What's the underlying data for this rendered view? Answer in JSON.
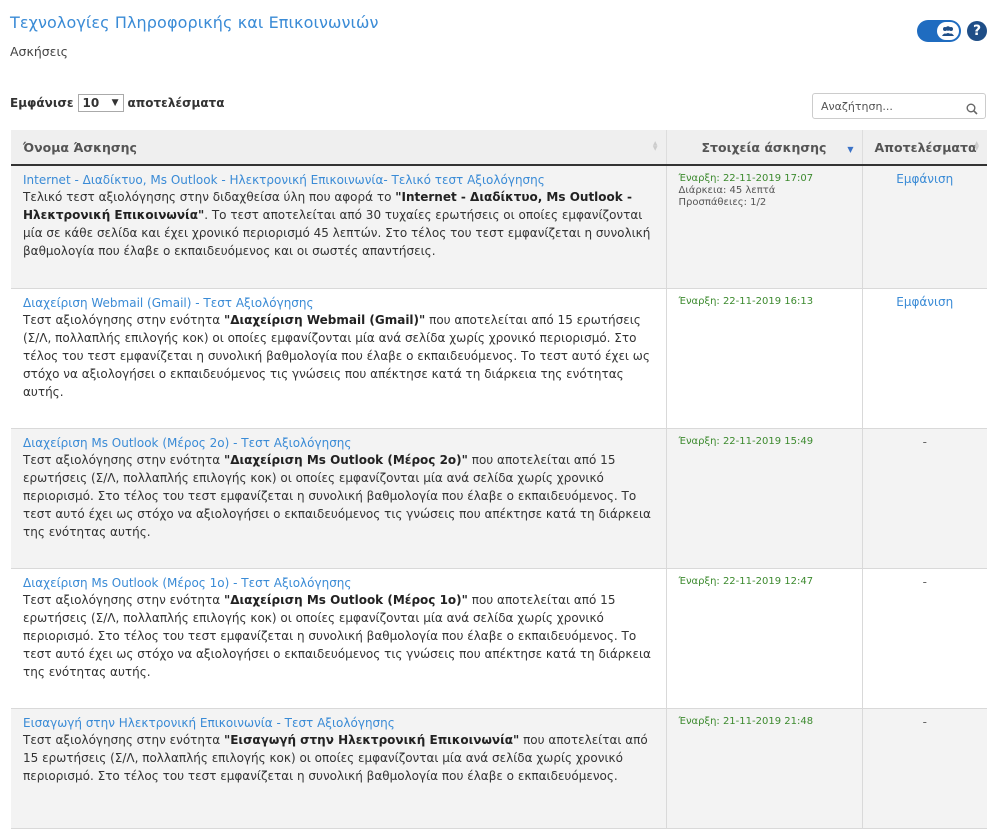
{
  "header": {
    "course_title": "Τεχνολογίες Πληροφορικής και Επικοινωνιών",
    "page_subtitle": "Ασκήσεις"
  },
  "controls": {
    "show_label": "Εμφάνισε",
    "page_size": "10",
    "results_label": "αποτελέσματα",
    "search_placeholder": "Αναζήτηση..."
  },
  "table": {
    "columns": [
      "Όνομα Άσκησης",
      "Στοιχεία άσκησης",
      "Αποτελέσματα"
    ],
    "rows": [
      {
        "title": "Internet - Διαδίκτυο, Ms Outlook - Ηλεκτρονική Επικοινωνία- Τελικό τεστ Αξιολόγησης",
        "desc_pre": "Τελικό τεστ αξιολόγησης στην διδαχθείσα ύλη που αφορά το ",
        "desc_bold": "\"Internet - Διαδίκτυο, Ms Outlook - Ηλεκτρονική Επικοινωνία\"",
        "desc_post": ". Το τεστ αποτελείται από 30 τυχαίες ερωτήσεις οι οποίες εμφανίζονται μία σε κάθε σελίδα και έχει χρονικό περιορισμό 45 λεπτών. Στο τέλος του τεστ εμφανίζεται η συνολική βαθμολογία που έλαβε ο εκπαιδευόμενος και οι σωστές απαντήσεις.",
        "start": "Έναρξη: 22-11-2019 17:07",
        "duration": "Διάρκεια: 45 λεπτά",
        "attempts": "Προσπάθειες: 1/2",
        "result": "Εμφάνιση"
      },
      {
        "title": "Διαχείριση Webmail (Gmail) - Τεστ Αξιολόγησης",
        "desc_pre": "Τεστ αξιολόγησης στην ενότητα ",
        "desc_bold": "\"Διαχείριση Webmail (Gmail)\"",
        "desc_post": " που αποτελείται από 15 ερωτήσεις (Σ/Λ, πολλαπλής επιλογής κοκ) οι οποίες εμφανίζονται μία ανά σελίδα χωρίς χρονικό περιορισμό. Στο τέλος του τεστ εμφανίζεται η συνολική βαθμολογία που έλαβε ο εκπαιδευόμενος. Το τεστ αυτό έχει ως στόχο να αξιολογήσει ο εκπαιδευόμενος τις γνώσεις που απέκτησε κατά τη διάρκεια της ενότητας αυτής.",
        "start": "Έναρξη: 22-11-2019 16:13",
        "duration": "",
        "attempts": "",
        "result": "Εμφάνιση"
      },
      {
        "title": "Διαχείριση Ms Outlook (Μέρος 2ο) - Τεστ Αξιολόγησης",
        "desc_pre": "Τεστ αξιολόγησης στην ενότητα ",
        "desc_bold": "\"Διαχείριση Ms Outlook (Μέρος 2ο)\"",
        "desc_post": " που αποτελείται από 15 ερωτήσεις (Σ/Λ, πολλαπλής επιλογής κοκ) οι οποίες εμφανίζονται μία ανά σελίδα χωρίς χρονικό περιορισμό. Στο τέλος του τεστ εμφανίζεται η συνολική βαθμολογία που έλαβε ο εκπαιδευόμενος. Το τεστ αυτό έχει ως στόχο να αξιολογήσει ο εκπαιδευόμενος τις γνώσεις που απέκτησε κατά τη διάρκεια της ενότητας αυτής.",
        "start": "Έναρξη: 22-11-2019 15:49",
        "duration": "",
        "attempts": "",
        "result": "-"
      },
      {
        "title": "Διαχείριση Ms Outlook (Μέρος 1ο) - Τεστ Αξιολόγησης",
        "desc_pre": "Τεστ αξιολόγησης στην ενότητα ",
        "desc_bold": "\"Διαχείριση Ms Outlook (Μέρος 1ο)\"",
        "desc_post": " που αποτελείται από 15 ερωτήσεις (Σ/Λ, πολλαπλής επιλογής κοκ) οι οποίες εμφανίζονται μία ανά σελίδα χωρίς χρονικό περιορισμό. Στο τέλος του τεστ εμφανίζεται η συνολική βαθμολογία που έλαβε ο εκπαιδευόμενος. Το τεστ αυτό έχει ως στόχο να αξιολογήσει ο εκπαιδευόμενος τις γνώσεις που απέκτησε κατά τη διάρκεια της ενότητας αυτής.",
        "start": "Έναρξη: 22-11-2019 12:47",
        "duration": "",
        "attempts": "",
        "result": "-"
      },
      {
        "title": "Εισαγωγή στην Ηλεκτρονική Επικοινωνία - Τεστ Αξιολόγησης",
        "desc_pre": "Τεστ αξιολόγησης στην ενότητα ",
        "desc_bold": "\"Εισαγωγή στην Ηλεκτρονική Επικοινωνία\"",
        "desc_post": " που αποτελείται από 15 ερωτήσεις (Σ/Λ, πολλαπλής επιλογής κοκ) οι οποίες εμφανίζονται μία ανά σελίδα χωρίς χρονικό περιορισμό. Στο τέλος του τεστ εμφανίζεται η συνολική βαθμολογία που έλαβε ο εκπαιδευόμενος.",
        "start": "Έναρξη: 21-11-2019 21:48",
        "duration": "",
        "attempts": "",
        "result": "-"
      }
    ]
  },
  "colors": {
    "link": "#3a8bd6",
    "start_date": "#3c8a2e",
    "toggle": "#1f6cc0",
    "help": "#1f4e87"
  },
  "icons": {
    "toggle": "users-icon",
    "help": "question-circle-icon",
    "search": "search-icon",
    "dropdown": "caret-down-icon"
  }
}
